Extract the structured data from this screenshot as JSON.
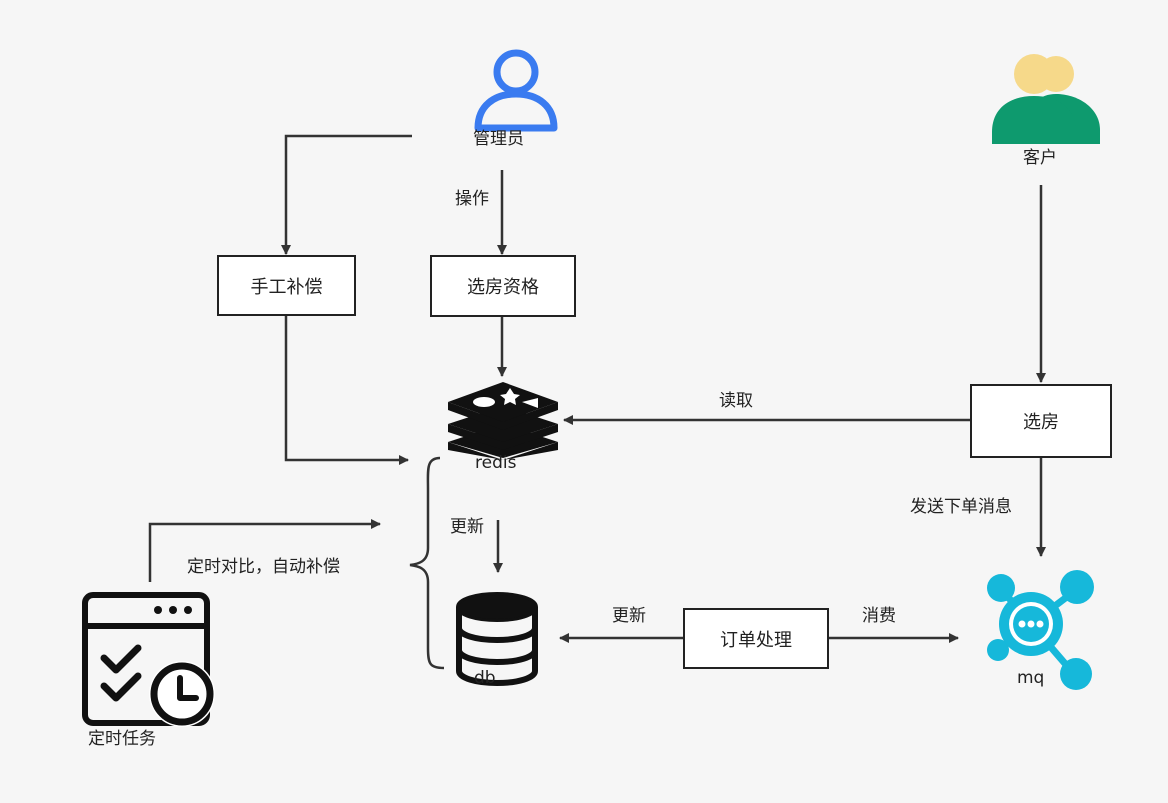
{
  "nodes": {
    "admin": "管理员",
    "customer": "客户",
    "manual_comp": "手工补偿",
    "eligibility": "选房资格",
    "redis": "redis",
    "choose_room": "选房",
    "db": "db",
    "order_proc": "订单处理",
    "mq": "mq",
    "scheduled_task": "定时任务"
  },
  "edges": {
    "operate": "操作",
    "read": "读取",
    "send_order_msg": "发送下单消息",
    "update_redis_db": "更新",
    "update_db": "更新",
    "consume": "消费",
    "timed_compare": "定时对比，自动补偿"
  },
  "colors": {
    "line": "#333333",
    "admin_icon": "#3a7bf0",
    "customer_front": "#0e9a6e",
    "customer_skin": "#f6d98a",
    "mq_icon": "#16b8da",
    "black_icon": "#111111"
  }
}
